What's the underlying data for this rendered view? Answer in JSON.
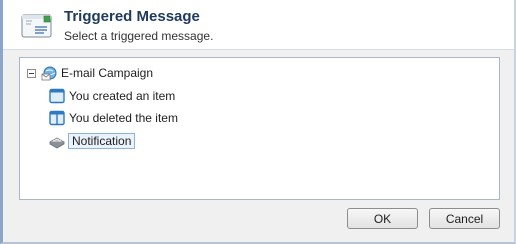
{
  "header": {
    "title": "Triggered Message",
    "subtitle": "Select a triggered message."
  },
  "tree": {
    "root": {
      "label": "E-mail Campaign",
      "icon": "campaign-globe-icon"
    },
    "children": [
      {
        "label": "You created an item",
        "icon": "created-item-icon"
      },
      {
        "label": "You deleted the item",
        "icon": "deleted-item-icon"
      },
      {
        "label": "Notification",
        "icon": "notification-icon",
        "selected": true
      }
    ]
  },
  "buttons": {
    "ok": "OK",
    "cancel": "Cancel"
  },
  "colors": {
    "title": "#1e3a5c",
    "selection_border": "#8cb3e0",
    "selection_fill": "#eaf2fb"
  }
}
